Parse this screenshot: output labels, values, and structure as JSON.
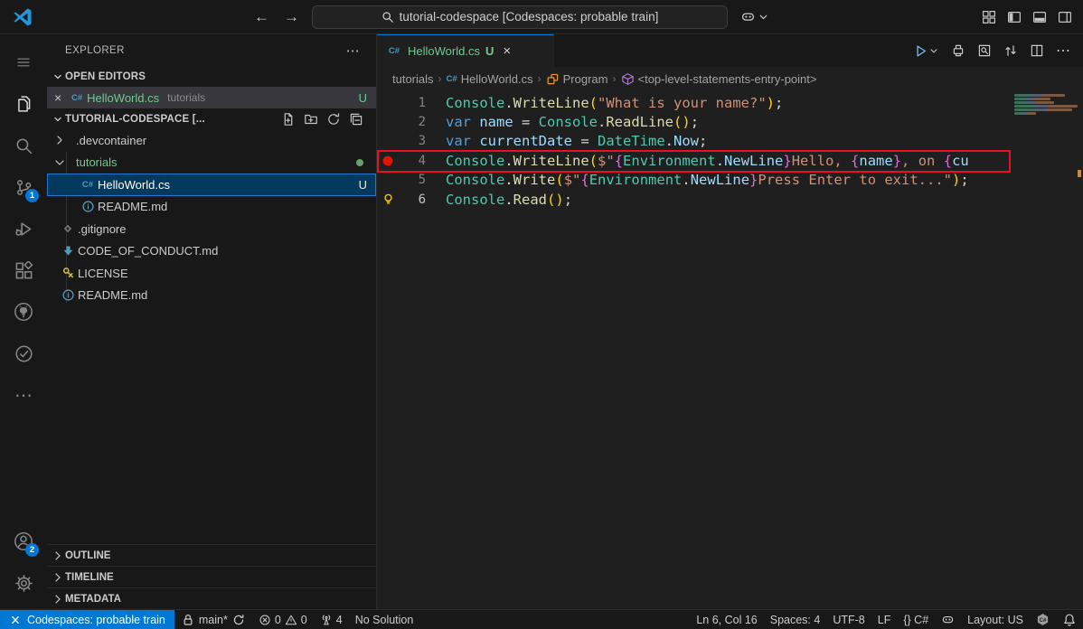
{
  "title_bar": {
    "search_text": "tutorial-codespace [Codespaces: probable train]",
    "nav": {
      "back": "←",
      "forward": "→"
    },
    "window_controls": [
      "layout",
      "panel-left",
      "panel-bottom",
      "panel-right"
    ]
  },
  "activity_bar": {
    "items": [
      {
        "name": "menu"
      },
      {
        "name": "explorer",
        "active": true
      },
      {
        "name": "search"
      },
      {
        "name": "source-control",
        "badge": "1"
      },
      {
        "name": "run-debug"
      },
      {
        "name": "extensions"
      },
      {
        "name": "github"
      },
      {
        "name": "testing"
      },
      {
        "name": "more"
      }
    ],
    "bottom": [
      {
        "name": "accounts",
        "badge": "2"
      },
      {
        "name": "settings"
      }
    ]
  },
  "sidebar": {
    "title": "EXPLORER",
    "more_label": "⋯",
    "open_editors": {
      "label": "OPEN EDITORS",
      "items": [
        {
          "file": "HelloWorld.cs",
          "desc": "tutorials",
          "badge": "U"
        }
      ]
    },
    "workspace": {
      "label": "TUTORIAL-CODESPACE [...",
      "actions": [
        "new-file",
        "new-folder",
        "refresh",
        "collapse-all"
      ]
    },
    "tree": [
      {
        "indent": 0,
        "twisty": "chevron-right",
        "label": ".devcontainer"
      },
      {
        "indent": 0,
        "twisty": "chevron-down",
        "label": "tutorials",
        "green": true,
        "dot": true
      },
      {
        "indent": 1,
        "icon": "csharp",
        "label": "HelloWorld.cs",
        "selected": true,
        "badge": "U"
      },
      {
        "indent": 1,
        "icon": "info",
        "label": "README.md"
      },
      {
        "indent": 0,
        "icon": "git-diamond",
        "label": ".gitignore"
      },
      {
        "indent": 0,
        "icon": "md-arrow",
        "label": "CODE_OF_CONDUCT.md"
      },
      {
        "indent": 0,
        "icon": "license-key",
        "label": "LICENSE"
      },
      {
        "indent": 0,
        "icon": "info",
        "label": "README.md"
      }
    ],
    "panels": [
      "OUTLINE",
      "TIMELINE",
      "METADATA"
    ]
  },
  "editor": {
    "tab": {
      "file": "HelloWorld.cs",
      "dirty": "U",
      "close": "×"
    },
    "actions": [
      "print",
      "search-preview",
      "open-changes",
      "split-editor",
      "more"
    ],
    "breadcrumbs": [
      {
        "label": "tutorials"
      },
      {
        "label": "HelloWorld.cs",
        "icon": "csharp"
      },
      {
        "label": "Program",
        "icon": "symbol-class"
      },
      {
        "label": "<top-level-statements-entry-point>",
        "icon": "symbol-namespace"
      }
    ],
    "lines": [
      {
        "num": "1",
        "tokens": [
          [
            "Console",
            "type"
          ],
          [
            ".",
            "plain"
          ],
          [
            "WriteLine",
            "method"
          ],
          [
            "(",
            "b1"
          ],
          [
            "\"What is your name?\"",
            "str"
          ],
          [
            ")",
            "b1"
          ],
          [
            ";",
            "plain"
          ]
        ]
      },
      {
        "num": "2",
        "tokens": [
          [
            "var",
            "kw"
          ],
          [
            " ",
            "plain"
          ],
          [
            "name",
            "var"
          ],
          [
            " = ",
            "plain"
          ],
          [
            "Console",
            "type"
          ],
          [
            ".",
            "plain"
          ],
          [
            "ReadLine",
            "method"
          ],
          [
            "(",
            "b1"
          ],
          [
            ")",
            "b1"
          ],
          [
            ";",
            "plain"
          ]
        ]
      },
      {
        "num": "3",
        "tokens": [
          [
            "var",
            "kw"
          ],
          [
            " ",
            "plain"
          ],
          [
            "currentDate",
            "var"
          ],
          [
            " = ",
            "plain"
          ],
          [
            "DateTime",
            "type"
          ],
          [
            ".",
            "plain"
          ],
          [
            "Now",
            "var"
          ],
          [
            ";",
            "plain"
          ]
        ]
      },
      {
        "num": "4",
        "breakpoint": true,
        "boxed": true,
        "tokens": [
          [
            "Console",
            "type"
          ],
          [
            ".",
            "plain"
          ],
          [
            "WriteLine",
            "method"
          ],
          [
            "(",
            "b1"
          ],
          [
            "$\"",
            "str"
          ],
          [
            "{",
            "b2"
          ],
          [
            "Environment",
            "type"
          ],
          [
            ".",
            "plain"
          ],
          [
            "NewLine",
            "var"
          ],
          [
            "}",
            "b2"
          ],
          [
            "Hello, ",
            "str"
          ],
          [
            "{",
            "b2"
          ],
          [
            "name",
            "var"
          ],
          [
            "}",
            "b2"
          ],
          [
            ", on ",
            "str"
          ],
          [
            "{",
            "b2"
          ],
          [
            "cu",
            "var"
          ]
        ]
      },
      {
        "num": "5",
        "tokens": [
          [
            "Console",
            "type"
          ],
          [
            ".",
            "plain"
          ],
          [
            "Write",
            "method"
          ],
          [
            "(",
            "b1"
          ],
          [
            "$\"",
            "str"
          ],
          [
            "{",
            "b2"
          ],
          [
            "Environment",
            "type"
          ],
          [
            ".",
            "plain"
          ],
          [
            "NewLine",
            "var"
          ],
          [
            "}",
            "b2"
          ],
          [
            "Press Enter to exit...\"",
            "str"
          ],
          [
            ")",
            "b1"
          ],
          [
            ";",
            "plain"
          ]
        ]
      },
      {
        "num": "6",
        "lightbulb": true,
        "current": true,
        "tokens": [
          [
            "Console",
            "type"
          ],
          [
            ".",
            "plain"
          ],
          [
            "Read",
            "method"
          ],
          [
            "(",
            "b1"
          ],
          [
            ")",
            "b1"
          ],
          [
            ";",
            "plain"
          ]
        ]
      }
    ],
    "minimap_rows": [
      56,
      40,
      44,
      70,
      64,
      24
    ],
    "highlight_box": {
      "line": 4,
      "color": "#e81123"
    }
  },
  "status_bar": {
    "left": [
      {
        "name": "remote-indicator",
        "accent": true,
        "parts": [
          [
            "icon",
            "remote"
          ],
          [
            "text",
            "Codespaces: probable train"
          ]
        ]
      },
      {
        "name": "git-branch",
        "parts": [
          [
            "icon",
            "lock"
          ],
          [
            "text",
            "main*"
          ],
          [
            "icon",
            "sync"
          ]
        ]
      },
      {
        "name": "problems",
        "parts": [
          [
            "icon",
            "error"
          ],
          [
            "text",
            "0"
          ],
          [
            "icon",
            "warning"
          ],
          [
            "text",
            "0"
          ]
        ]
      },
      {
        "name": "forwarded-ports",
        "parts": [
          [
            "icon",
            "radio-tower"
          ],
          [
            "text",
            "4"
          ]
        ]
      },
      {
        "name": "solution",
        "parts": [
          [
            "text",
            "No Solution"
          ]
        ]
      }
    ],
    "right": [
      {
        "name": "cursor-position",
        "parts": [
          [
            "text",
            "Ln 6, Col 16"
          ]
        ]
      },
      {
        "name": "indentation",
        "parts": [
          [
            "text",
            "Spaces: 4"
          ]
        ]
      },
      {
        "name": "encoding",
        "parts": [
          [
            "text",
            "UTF-8"
          ]
        ]
      },
      {
        "name": "eol",
        "parts": [
          [
            "text",
            "LF"
          ]
        ]
      },
      {
        "name": "language-mode",
        "parts": [
          [
            "text",
            "{} C#"
          ]
        ]
      },
      {
        "name": "copilot",
        "parts": [
          [
            "icon",
            "copilot"
          ]
        ]
      },
      {
        "name": "keyboard-layout",
        "parts": [
          [
            "text",
            "Layout: US"
          ]
        ]
      },
      {
        "name": "csharp-project",
        "parts": [
          [
            "icon",
            "csharp-hex"
          ]
        ]
      },
      {
        "name": "notifications",
        "parts": [
          [
            "icon",
            "bell"
          ]
        ]
      }
    ]
  },
  "colors": {
    "accent": "#0078d4",
    "modified_green": "#73c991",
    "breakpoint_red": "#e51400",
    "highlight_box_red": "#e81123",
    "selection_blue": "#04395e"
  }
}
